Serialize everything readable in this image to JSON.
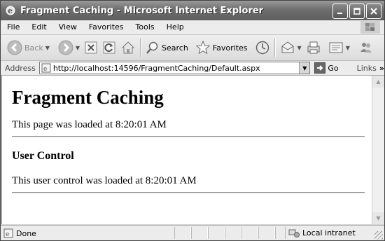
{
  "window": {
    "title": "Fragment Caching - Microsoft Internet Explorer"
  },
  "menu": {
    "items": [
      "File",
      "Edit",
      "View",
      "Favorites",
      "Tools",
      "Help"
    ]
  },
  "toolbar": {
    "back_label": "Back",
    "search_label": "Search",
    "favorites_label": "Favorites"
  },
  "address": {
    "label": "Address",
    "url": "http://localhost:14596/FragmentCaching/Default.aspx",
    "go_label": "Go",
    "links_label": "Links",
    "chevron": "»"
  },
  "page": {
    "heading": "Fragment Caching",
    "loaded_text": "This page was loaded at 8:20:01 AM",
    "control_heading": "User Control",
    "control_text": "This user control was loaded at 8:20:01 AM"
  },
  "status": {
    "text": "Done",
    "zone": "Local intranet"
  }
}
